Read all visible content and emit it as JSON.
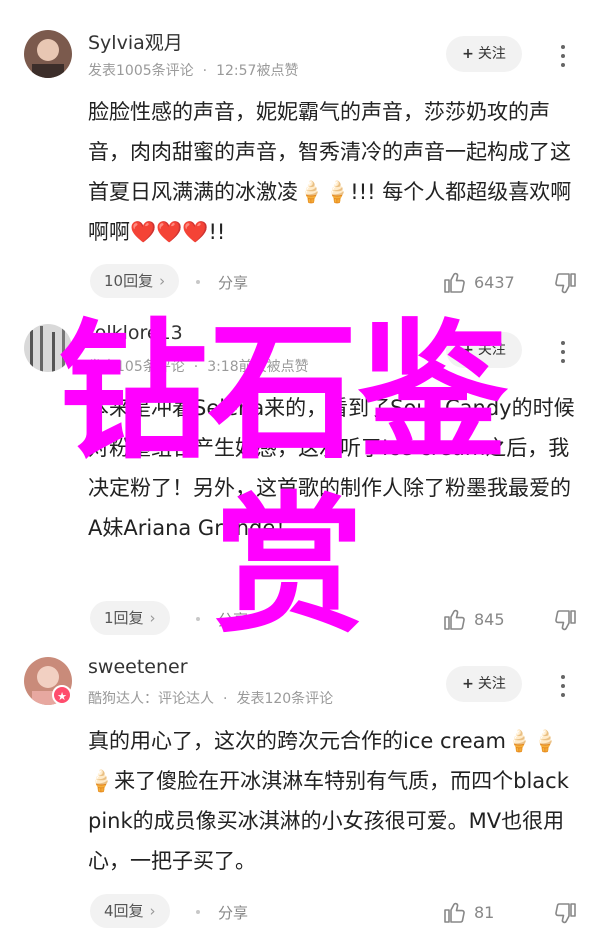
{
  "comments": [
    {
      "name": "Sylvia观月",
      "meta_parts": [
        "发表1005条评论",
        "12:57被点赞"
      ],
      "follow_label": "关注",
      "body": "脸脸性感的声音，妮妮霸气的声音，莎莎奶攻的声音，肉肉甜蜜的声音，智秀清冷的声音一起构成了这首夏日风满满的冰激凌🍦🍦!!! 每个人都超级喜欢啊啊啊❤️❤️❤️!!",
      "replies_label": "10回复",
      "share_label": "分享",
      "likes": "6437",
      "avatar_colors": [
        "#8a6a5c",
        "#d9b8a3"
      ]
    },
    {
      "name": "folklore13",
      "meta_parts": [
        "发表105条评论",
        "3:18前天被点赞"
      ],
      "follow_label": "关注",
      "body": "本来是冲着Selena来的，看到了Sour Candy的时候对粉墨组合产生好感，这次听了Ice cream之后，我决定粉了！另外，这首歌的制作人除了粉墨我最爱的A妹Ariana Grande！",
      "replies_label": "1回复",
      "share_label": "分享",
      "likes": "845",
      "avatar_colors": [
        "#6f6f6f",
        "#cfcfcf"
      ]
    },
    {
      "name": "sweetener",
      "meta_parts": [
        "酷狗达人：评论达人",
        "发表120条评论"
      ],
      "follow_label": "关注",
      "body": "真的用心了，这次的跨次元合作的ice cream🍦🍦🍦来了傻脸在开冰淇淋车特别有气质，而四个blackpink的成员像买冰淇淋的小女孩很可爱。MV也很用心，一把子买了。",
      "replies_label": "4回复",
      "share_label": "分享",
      "likes": "81",
      "avatar_colors": [
        "#c98b7a",
        "#f2d0c2"
      ]
    }
  ],
  "watermark": "钻石鉴赏",
  "colors": {
    "watermark": "#ff00ff",
    "badge": "#ff4d6d"
  },
  "icons": [
    "more-icon",
    "thumbs-up-icon",
    "thumbs-down-icon",
    "chevron-right-icon",
    "plus-icon"
  ]
}
